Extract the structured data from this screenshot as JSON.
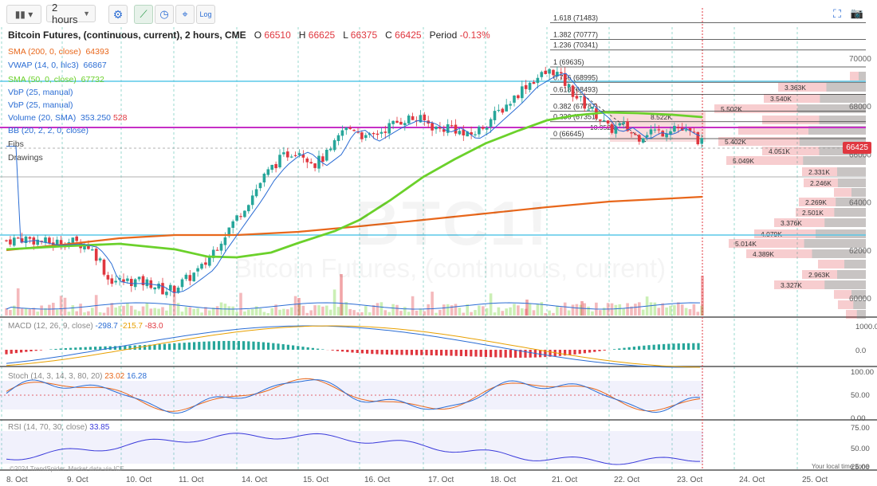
{
  "toolbar": {
    "timeframe": "2 hours",
    "log_label": "Log"
  },
  "header": {
    "title": "Bitcoin Futures, (continuous, current), 2 hours, CME",
    "open_label": "O",
    "open": "66510",
    "high_label": "H",
    "high": "66625",
    "low_label": "L",
    "low": "66375",
    "close_label": "C",
    "close": "66425",
    "period_label": "Period",
    "period": "-0.13%"
  },
  "studies": [
    {
      "name": "SMA (200, 0, close)",
      "value": "64393",
      "color": "#e8671b"
    },
    {
      "name": "VWAP (14, 0, hlc3)",
      "value": "66867",
      "color": "#2b6dd4"
    },
    {
      "name": "SMA (50, 0, close)",
      "value": "67732",
      "color": "#6bd12b"
    },
    {
      "name": "VbP (25, manual)",
      "value": "",
      "color": "#555"
    },
    {
      "name": "VbP (25, manual)",
      "value": "",
      "color": "#555"
    },
    {
      "name": "Volume (20, SMA)",
      "value": "353.250",
      "value2": "528",
      "color": "#2b6dd4"
    },
    {
      "name": "BB (20, 2, 2, 0, close)",
      "value": "",
      "color": "#9a4fd1"
    },
    {
      "name": "Fibs",
      "value": "",
      "color": "#555"
    },
    {
      "name": "Drawings",
      "value": "",
      "color": "#555"
    }
  ],
  "watermark": {
    "symbol": "BTC1!",
    "name": "Bitcoin Futures, (continuous, current)"
  },
  "price_tag": "66425",
  "y_axis_labels": [
    "70000",
    "68000",
    "66000",
    "64000",
    "62000",
    "60000"
  ],
  "fib_labels": [
    {
      "text": "1.618 (71483)",
      "value": 71483
    },
    {
      "text": "1.382 (70777)",
      "value": 70777
    },
    {
      "text": "1.236 (70341)",
      "value": 70341
    },
    {
      "text": "1 (69635)",
      "value": 69635
    },
    {
      "text": "0.786 (68995)",
      "value": 68995
    },
    {
      "text": "0.618 (68493)",
      "value": 68493
    },
    {
      "text": "0.382 (67787)",
      "value": 67787
    },
    {
      "text": "0.236 (67351)",
      "value": 67351
    },
    {
      "text": "0 (66645)",
      "value": 66645
    }
  ],
  "vbp_labels": [
    "3.363K",
    "3.540K",
    "5.502K",
    "5.402K",
    "4.051K",
    "5.049K",
    "2.331K",
    "2.246K",
    "2.269K",
    "2.501K",
    "3.376K",
    "4.079K",
    "5.014K",
    "4.389K",
    "2.963K",
    "3.327K",
    "10.952K",
    "8.522K"
  ],
  "macd": {
    "label": "MACD (12, 26, 9, close)",
    "v1": "-298.7",
    "v2": "-215.7",
    "v3": "-83.0",
    "axis": [
      "1000.0",
      "0.0"
    ]
  },
  "stoch": {
    "label": "Stoch (14, 3, 14, 3, 80, 20)",
    "v1": "23.02",
    "v2": "16.28",
    "axis": [
      "100.00",
      "50.00",
      "0.00"
    ]
  },
  "rsi": {
    "label": "RSI (14, 70, 30, close)",
    "v1": "33.85",
    "axis": [
      "75.00",
      "50.00",
      "25.00"
    ]
  },
  "x_axis_labels": [
    "8. Oct",
    "9. Oct",
    "10. Oct",
    "11. Oct",
    "14. Oct",
    "15. Oct",
    "16. Oct",
    "17. Oct",
    "18. Oct",
    "21. Oct",
    "22. Oct",
    "23. Oct",
    "24. Oct",
    "25. Oct"
  ],
  "copyright": "©2024 TrendSpider. Market data via ICE",
  "local_time": "Your local time zone",
  "colors": {
    "up": "#26a69a",
    "down": "#e0373f",
    "sma200": "#e8671b",
    "sma50": "#6bd12b",
    "vwap": "#2b6dd4",
    "hline_cyan": "#5bc8e8",
    "hline_magenta": "#c630c6"
  }
}
